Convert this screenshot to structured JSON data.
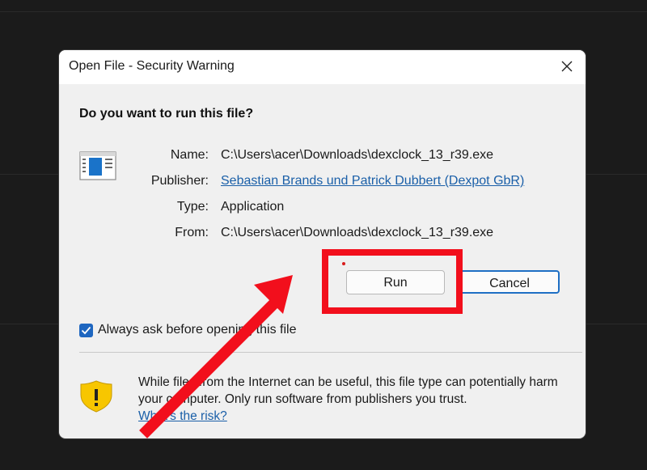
{
  "dialog": {
    "title": "Open File - Security Warning",
    "question": "Do you want to run this file?",
    "fields": {
      "name_label": "Name:",
      "name_value": "C:\\Users\\acer\\Downloads\\dexclock_13_r39.exe",
      "publisher_label": "Publisher:",
      "publisher_value": "Sebastian Brands und Patrick Dubbert (Dexpot GbR)",
      "type_label": "Type:",
      "type_value": "Application",
      "from_label": "From:",
      "from_value": "C:\\Users\\acer\\Downloads\\dexclock_13_r39.exe"
    },
    "buttons": {
      "run": "Run",
      "cancel": "Cancel"
    },
    "checkbox": {
      "label": "Always ask before opening this file",
      "checked": true
    },
    "warning": {
      "text": "While files from the Internet can be useful, this file type can potentially harm your computer. Only run software from publishers you trust.",
      "link": "What's the risk?"
    }
  },
  "icons": {
    "close": "close-icon",
    "app": "application-window-icon",
    "shield": "warning-shield-icon",
    "check": "checkmark-icon"
  },
  "colors": {
    "annotation_red": "#f20f1c",
    "link_blue": "#1a5fa8",
    "accent_blue": "#1e66c0",
    "shield_yellow": "#f7c600"
  }
}
